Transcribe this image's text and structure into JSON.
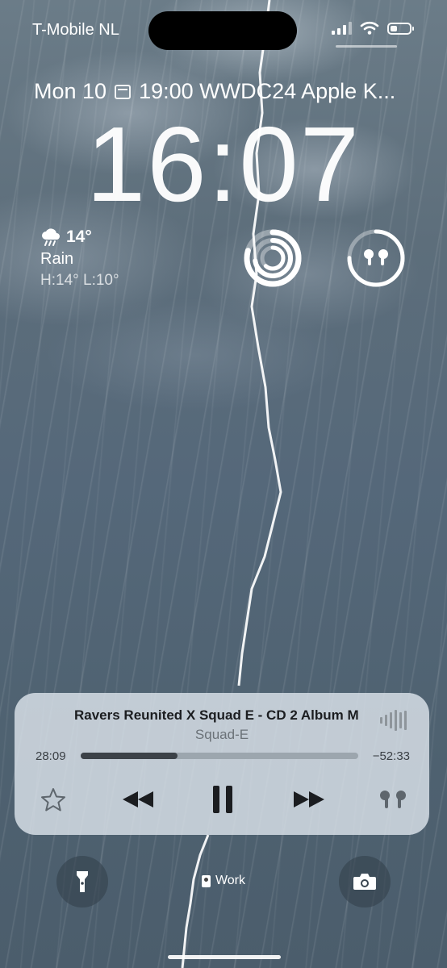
{
  "status_bar": {
    "carrier": "T-Mobile NL"
  },
  "lock": {
    "date_prefix": "Mon 10",
    "event": "19:00 WWDC24 Apple K...",
    "time": "16:07"
  },
  "weather": {
    "temp": "14°",
    "condition": "Rain",
    "high_low": "H:14° L:10°",
    "icon": "cloud-rain-icon"
  },
  "widgets": {
    "activity_ring_icon": "activity-rings-icon",
    "airpods_icon": "airpods-icon",
    "airpods_battery_level": 0.75
  },
  "now_playing": {
    "title": "Ravers Reunited X Squad E - CD 2 Album M",
    "artist": "Squad-E",
    "elapsed": "28:09",
    "remaining": "−52:33",
    "progress": 0.35,
    "icons": [
      "star-icon",
      "rewind-icon",
      "pause-icon",
      "fast-forward-icon",
      "airpods-output-icon",
      "audio-waveform-icon"
    ]
  },
  "bottom": {
    "focus_label": "Work",
    "left_button_icon": "flashlight-icon",
    "right_button_icon": "camera-icon"
  },
  "colors": {
    "sky_top": "#6b7c88",
    "sky_bottom": "#4b5d6c",
    "player_bg": "#dee6ee"
  }
}
